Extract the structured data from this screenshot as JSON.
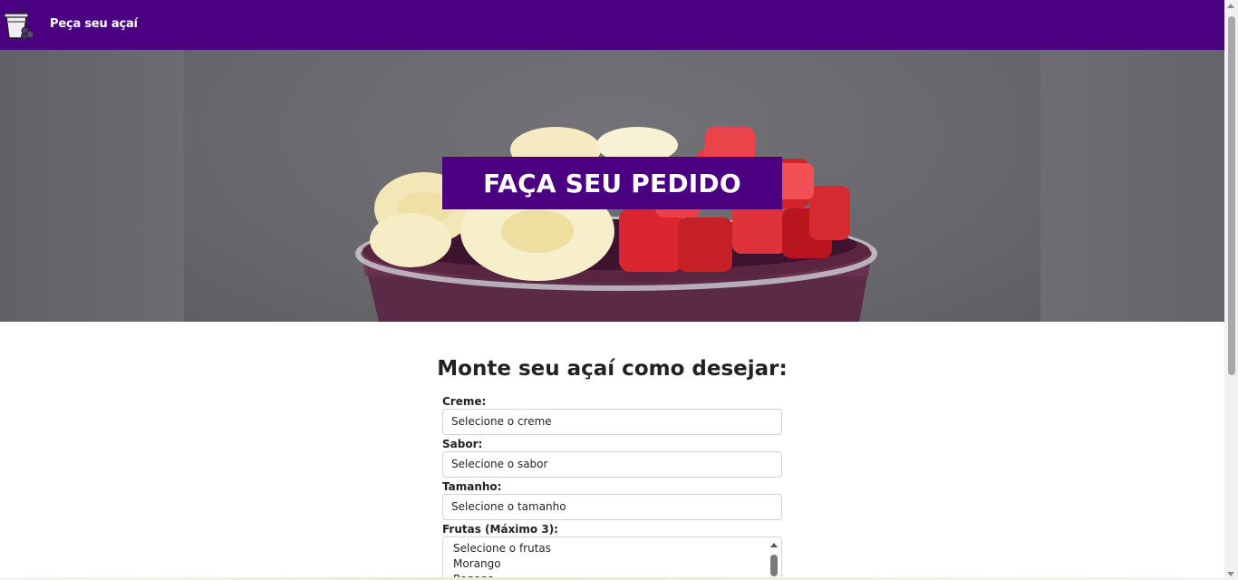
{
  "navbar": {
    "brand_label": "Peça seu açaí",
    "logo_icon": "acai-cup-icon",
    "color": "#4b0082"
  },
  "hero": {
    "title": "FAÇA SEU PEDIDO",
    "image": "acai-bowl-with-banana-and-strawberry"
  },
  "form": {
    "title": "Monte seu açaí como desejar:",
    "fields": [
      {
        "label": "Creme:",
        "value": "Selecione o creme"
      },
      {
        "label": "Sabor:",
        "value": "Selecione o sabor"
      },
      {
        "label": "Tamanho:",
        "value": "Selecione o tamanho"
      }
    ],
    "fruits": {
      "label": "Frutas (Máximo 3):",
      "options": [
        "Selecione o frutas",
        "Morango",
        "Banana"
      ]
    }
  }
}
